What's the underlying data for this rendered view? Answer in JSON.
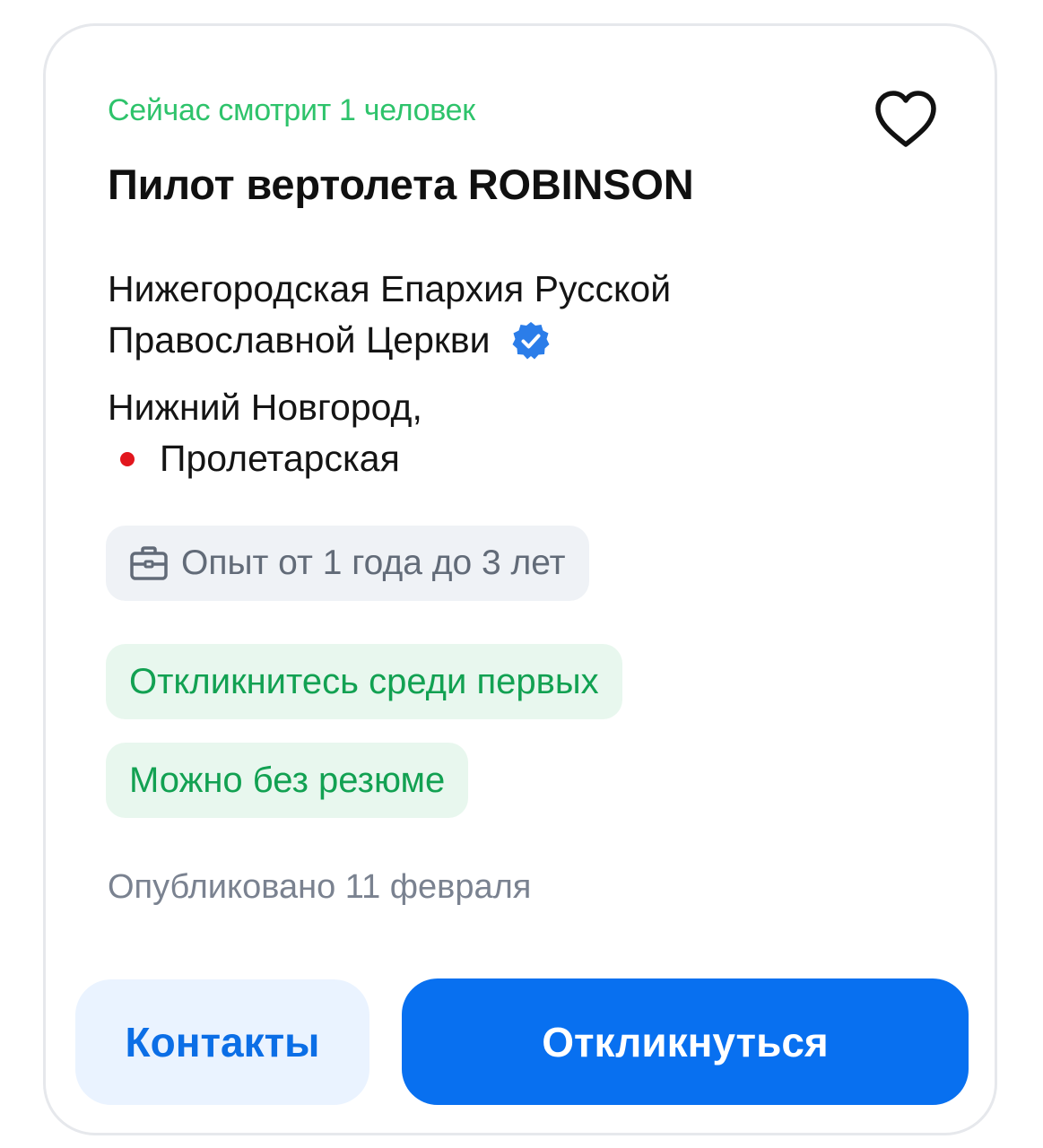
{
  "vacancy": {
    "viewers_text": "Сейчас смотрит 1 человек",
    "title": "Пилот вертолета ROBINSON",
    "company_line1": "Нижегородская Епархия Русской",
    "company_line2": "Православной Церкви",
    "city": "Нижний Новгород,",
    "metro_station": "Пролетарская",
    "experience": "Опыт от 1 года до 3 лет",
    "tags": [
      "Откликнитесь среди первых",
      "Можно без резюме"
    ],
    "published": "Опубликовано 11 февраля"
  },
  "actions": {
    "contacts_label": "Контакты",
    "respond_label": "Откликнуться"
  },
  "icons": {
    "favorite": "heart-icon",
    "verified": "verified-badge-icon",
    "experience": "briefcase-icon",
    "metro": "metro-dot-icon"
  },
  "colors": {
    "accent_green": "#2ec36b",
    "tag_green": "#12a152",
    "primary_blue": "#0870f0",
    "metro_red": "#e2161d"
  }
}
